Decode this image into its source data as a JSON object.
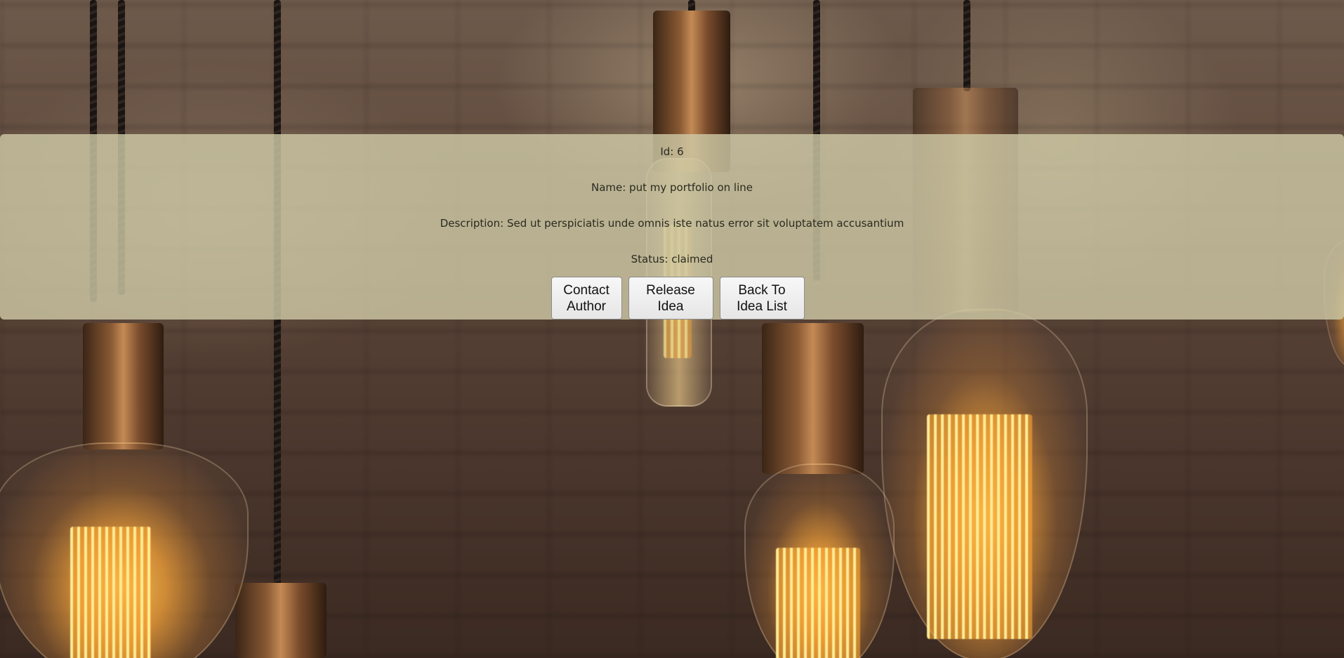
{
  "idea": {
    "id_text": "Id: 6",
    "name_text": "Name: put my portfolio on line",
    "description_text": "Description: Sed ut perspiciatis unde omnis iste natus error sit voluptatem accusantium",
    "status_text": "Status: claimed"
  },
  "buttons": {
    "contact_line1": "Contact",
    "contact_line2": "Author",
    "release_line1": "Release",
    "release_line2": "Idea",
    "back_line1": "Back To",
    "back_line2": "Idea List"
  },
  "colors": {
    "panel_background": "#cdc8a5",
    "button_background": "#efefef",
    "text": "#2a2a20"
  },
  "background_image": "edison-bulbs-brick-wall"
}
